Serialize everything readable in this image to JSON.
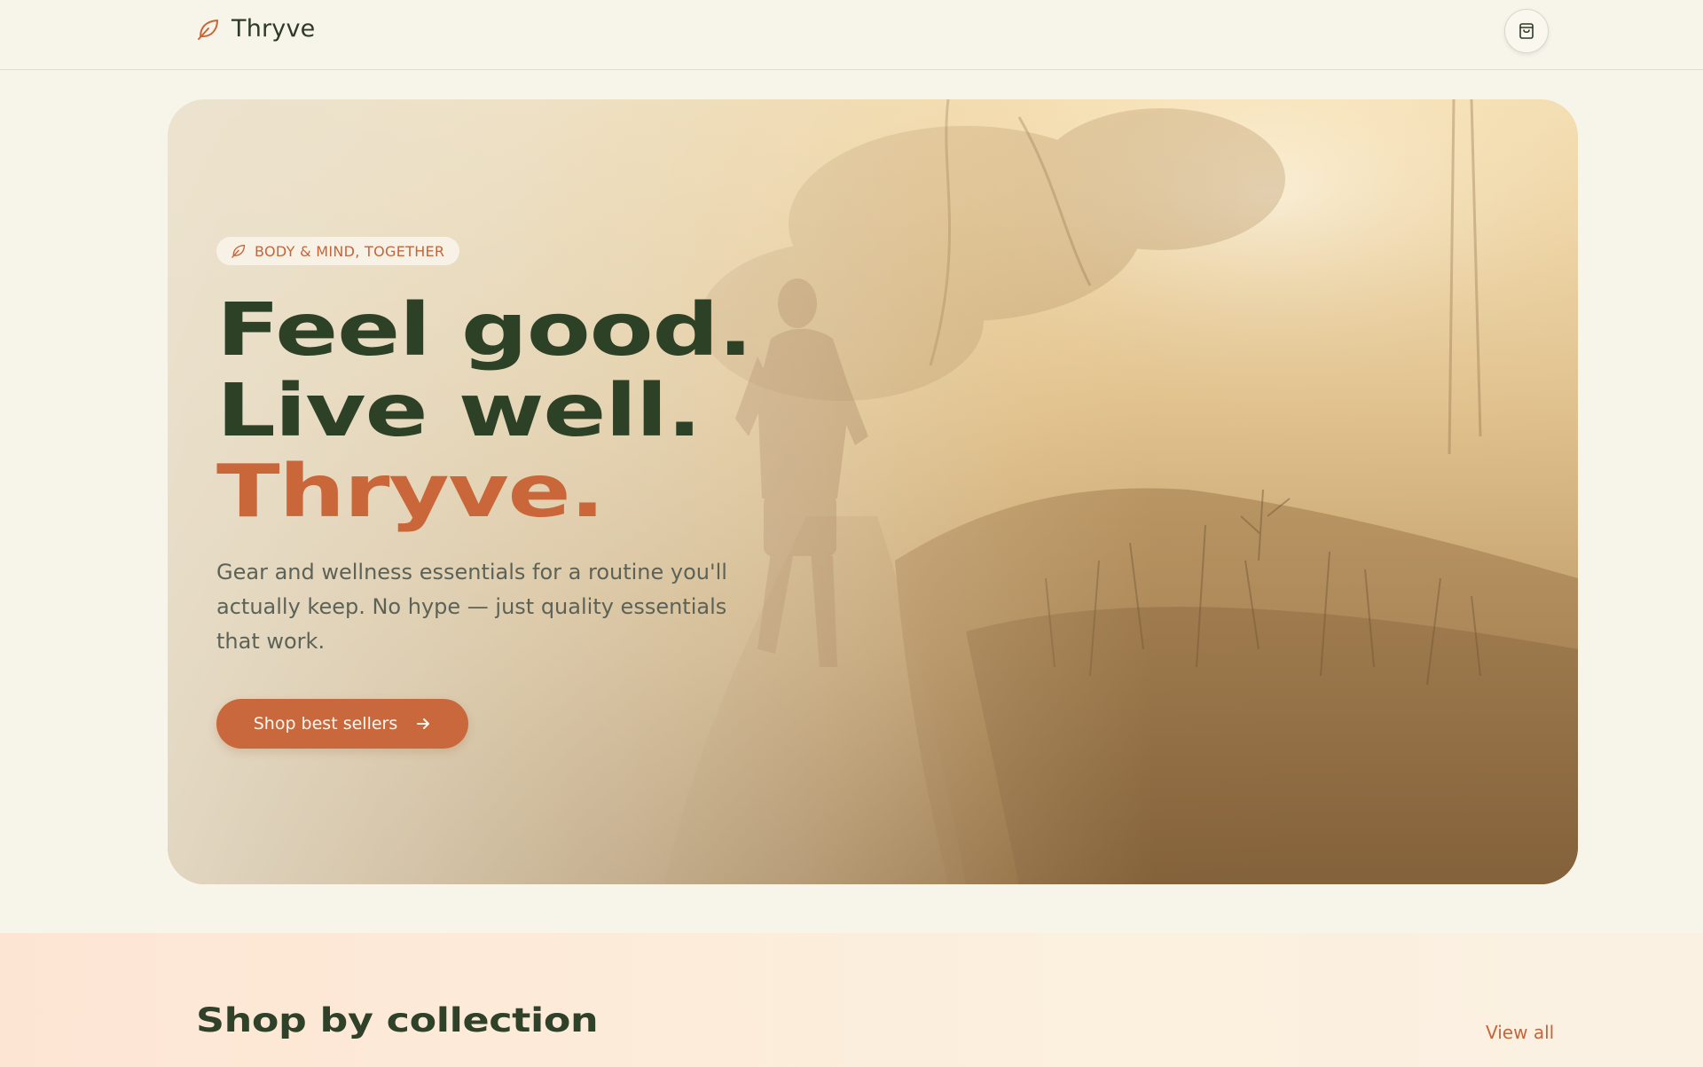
{
  "header": {
    "brand_name": "Thryve",
    "brand_icon": "leaf-icon",
    "cart_icon": "shopping-bag-icon"
  },
  "hero": {
    "pill_icon": "leaf-icon",
    "pill_text": "BODY & MIND, TOGETHER",
    "headline": [
      "Feel good.",
      "Live well.",
      "Thryve."
    ],
    "subcopy": "Gear and wellness essentials for a routine you'll actually keep. No hype — just quality essentials that work.",
    "cta_label": "Shop best sellers",
    "cta_icon": "arrow-right-icon",
    "background_image": "runner-on-misty-path"
  },
  "collections": {
    "title": "Shop by collection",
    "view_all_label": "View all"
  },
  "colors": {
    "accent": "#c9683c",
    "primary_text": "#2d4126",
    "background": "#f7f4e9"
  }
}
